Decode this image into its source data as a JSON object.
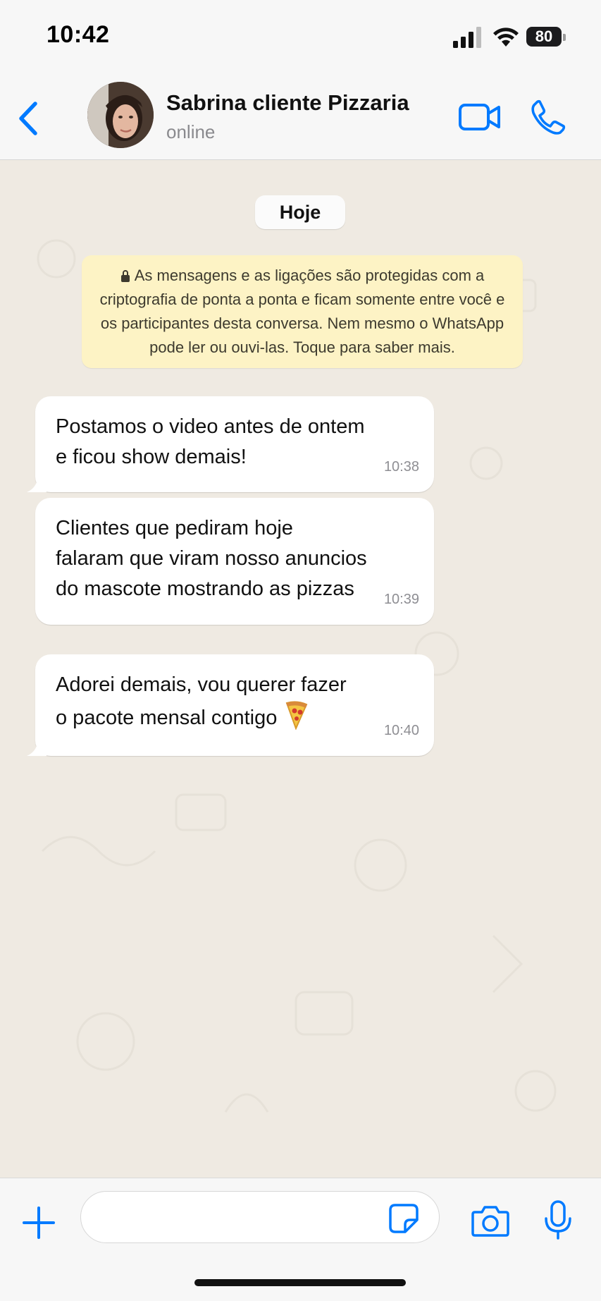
{
  "status_bar": {
    "time": "10:42",
    "battery": "80",
    "icons": [
      "signal-bars-icon",
      "wifi-icon",
      "battery-icon"
    ]
  },
  "header": {
    "back_icon": "chevron-left-icon",
    "contact_name": "Sabrina cliente Pizzaria",
    "contact_status": "online",
    "video_call_icon": "video-camera-icon",
    "voice_call_icon": "phone-icon"
  },
  "chat": {
    "day_label": "Hoje",
    "encryption_notice": "As mensagens e as ligações são protegidas com a criptografia de ponta a ponta e ficam somente entre você e os participantes desta conversa. Nem mesmo o WhatsApp pode ler ou ouvi-las. Toque para saber mais.",
    "messages": [
      {
        "lines": [
          "Postamos o video antes de ontem",
          "e ficou show demais!"
        ],
        "time": "10:38"
      },
      {
        "lines": [
          "Clientes que pediram hoje",
          "falaram que viram nosso anuncios",
          "do mascote mostrando as pizzas"
        ],
        "time": "10:39"
      },
      {
        "lines": [
          "Adorei demais, vou querer fazer",
          "o pacote mensal contigo"
        ],
        "emoji": "pizza-icon",
        "time": "10:40"
      }
    ]
  },
  "composer": {
    "attach_icon": "plus-icon",
    "input_value": "",
    "sticker_icon": "sticker-icon",
    "camera_icon": "camera-icon",
    "mic_icon": "microphone-icon"
  },
  "colors": {
    "accent": "#007aff",
    "chat_background": "#efeae2",
    "encryption_notice_background": "#fdf3c5",
    "bubble_background": "#ffffff"
  }
}
